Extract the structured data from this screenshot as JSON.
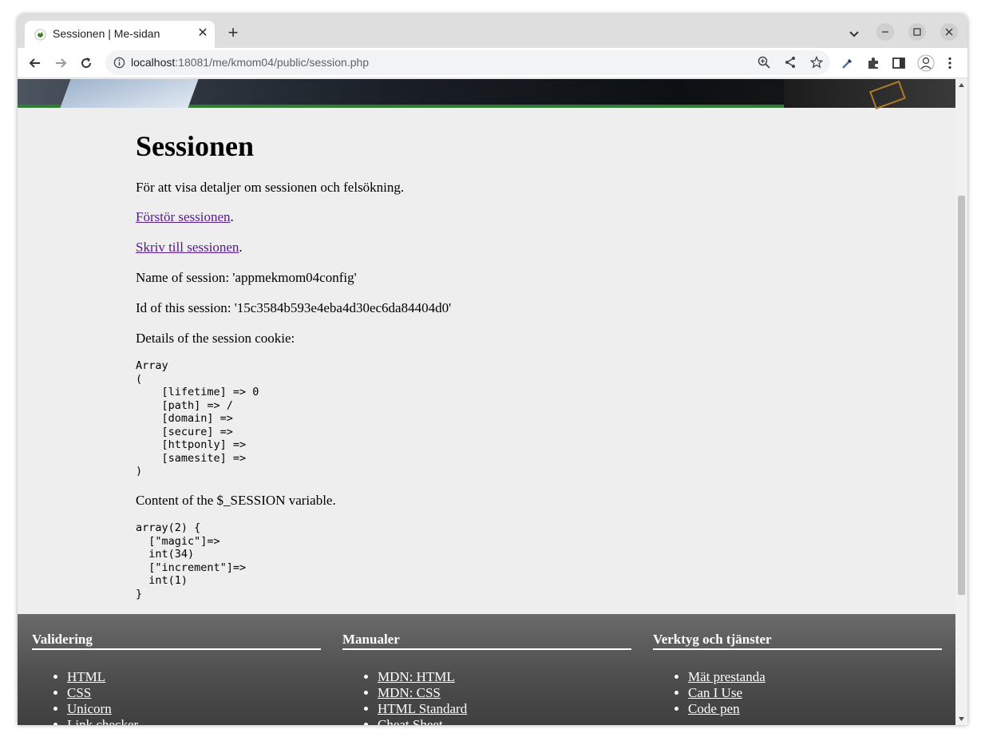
{
  "tab": {
    "title": "Sessionen | Me-sidan",
    "close_label": "✕",
    "favicon": "frog-favicon-icon"
  },
  "new_tab_label": "+",
  "address_bar": {
    "host": "localhost",
    "rest": ":18081/me/kmom04/public/session.php"
  },
  "page": {
    "heading": "Sessionen",
    "intro": "För att visa detaljer om sessionen och felsökning.",
    "destroy_link": "Förstör sessionen",
    "write_link": "Skriv till sessionen",
    "period": ".",
    "session_name": "Name of session: 'appmekmom04config'",
    "session_id": "Id of this session: '15c3584b593e4eba4d30ec6da84404d0'",
    "cookie_label": "Details of the session cookie:",
    "cookie_dump": "Array\n(\n    [lifetime] => 0\n    [path] => /\n    [domain] => \n    [secure] => \n    [httponly] => \n    [samesite] => \n)",
    "session_label": "Content of the $_SESSION variable.",
    "session_dump": "array(2) {\n  [\"magic\"]=>\n  int(34)\n  [\"increment\"]=>\n  int(1)\n}"
  },
  "footer": {
    "columns": [
      {
        "title": "Validering",
        "links": [
          "HTML",
          "CSS",
          "Unicorn",
          "Link checker"
        ]
      },
      {
        "title": "Manualer",
        "links": [
          "MDN: HTML",
          "MDN: CSS",
          "HTML Standard",
          "Cheat Sheet"
        ]
      },
      {
        "title": "Verktyg och tjänster",
        "links": [
          "Mät prestanda",
          "Can I Use",
          "Code pen"
        ]
      }
    ]
  }
}
